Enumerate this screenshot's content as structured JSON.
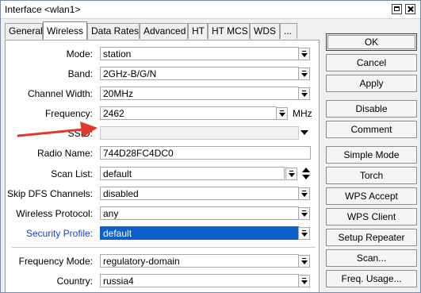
{
  "window": {
    "title": "Interface <wlan1>"
  },
  "tabs": [
    "General",
    "Wireless",
    "Data Rates",
    "Advanced",
    "HT",
    "HT MCS",
    "WDS",
    "..."
  ],
  "active_tab": "Wireless",
  "form": {
    "mode": {
      "label": "Mode:",
      "value": "station"
    },
    "band": {
      "label": "Band:",
      "value": "2GHz-B/G/N"
    },
    "channel_width": {
      "label": "Channel Width:",
      "value": "20MHz"
    },
    "frequency": {
      "label": "Frequency:",
      "value": "2462",
      "unit": "MHz"
    },
    "ssid": {
      "label": "SSID:",
      "value": ""
    },
    "radio_name": {
      "label": "Radio Name:",
      "value": "744D28FC4DC0"
    },
    "scan_list": {
      "label": "Scan List:",
      "value": "default"
    },
    "skip_dfs": {
      "label": "Skip DFS Channels:",
      "value": "disabled"
    },
    "wireless_protocol": {
      "label": "Wireless Protocol:",
      "value": "any"
    },
    "security_profile": {
      "label": "Security Profile:",
      "value": "default"
    },
    "frequency_mode": {
      "label": "Frequency Mode:",
      "value": "regulatory-domain"
    },
    "country": {
      "label": "Country:",
      "value": "russia4"
    }
  },
  "buttons": [
    "OK",
    "Cancel",
    "Apply",
    "Disable",
    "Comment",
    "Simple Mode",
    "Torch",
    "WPS Accept",
    "WPS Client",
    "Setup Repeater",
    "Scan...",
    "Freq. Usage..."
  ],
  "colors": {
    "link_label": "#1c3ec0",
    "selection": "#0a60c8",
    "arrow": "#e03a2f"
  }
}
